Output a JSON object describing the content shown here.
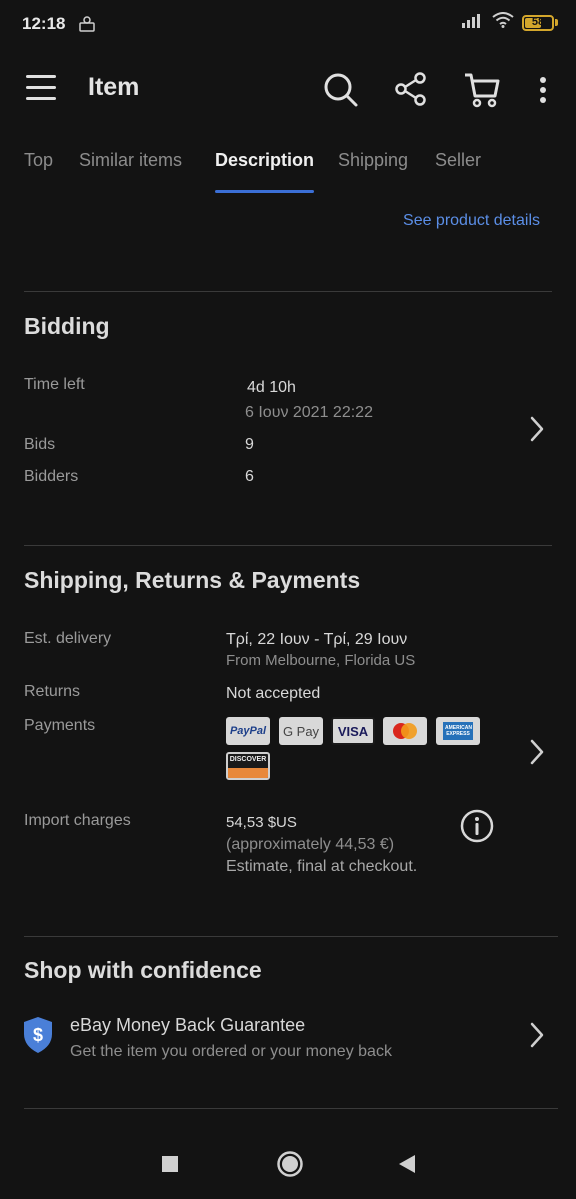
{
  "status_bar": {
    "time": "12:18",
    "battery": "58"
  },
  "app_bar": {
    "title": "Item"
  },
  "tabs": [
    {
      "label": "Top"
    },
    {
      "label": "Similar items"
    },
    {
      "label": "Description"
    },
    {
      "label": "Shipping"
    },
    {
      "label": "Seller"
    }
  ],
  "description": {
    "link": "See product details"
  },
  "bidding": {
    "title": "Bidding",
    "time_left_label": "Time left",
    "time_left_value": "4d 10h",
    "end_date": "6 Ιουν 2021 22:22",
    "bids_label": "Bids",
    "bids_value": "9",
    "bidders_label": "Bidders",
    "bidders_value": "6"
  },
  "shipping": {
    "title": "Shipping, Returns & Payments",
    "delivery_label": "Est. delivery",
    "delivery_value": "Τρί, 22 Ιουν - Τρί, 29 Ιουν",
    "delivery_from": "From Melbourne, Florida US",
    "returns_label": "Returns",
    "returns_value": "Not accepted",
    "payments_label": "Payments",
    "payment_methods": [
      "PayPal",
      "G Pay",
      "VISA",
      "mastercard-icon",
      "AMERICAN EXPRESS",
      "DISCOVER"
    ],
    "import_label": "Import charges",
    "import_value": "54,53 $US",
    "import_approx": "(approximately 44,53 €)",
    "import_note": "Estimate, final at checkout."
  },
  "confidence": {
    "title": "Shop with confidence",
    "guarantee_title": "eBay Money Back Guarantee",
    "guarantee_sub": "Get the item you ordered or your money back"
  },
  "colors": {
    "accent": "#3b6fd6",
    "link": "#5b8ee6",
    "shield": "#4a7fd8"
  }
}
